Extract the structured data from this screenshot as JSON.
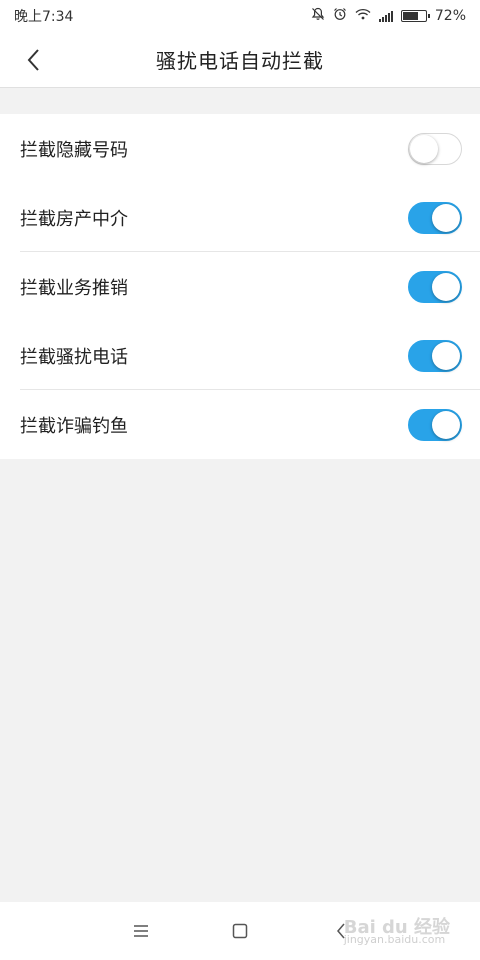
{
  "status_bar": {
    "time": "晚上7:34",
    "battery_percent": "72%",
    "battery_level": 0.72,
    "icons": [
      "bell-off-icon",
      "alarm-icon",
      "wifi-icon",
      "signal-icon",
      "battery-icon"
    ]
  },
  "header": {
    "title": "骚扰电话自动拦截",
    "back_icon": "chevron-left-icon"
  },
  "settings": [
    {
      "label": "拦截隐藏号码",
      "enabled": false
    },
    {
      "label": "拦截房产中介",
      "enabled": true
    },
    {
      "label": "拦截业务推销",
      "enabled": true
    },
    {
      "label": "拦截骚扰电话",
      "enabled": true
    },
    {
      "label": "拦截诈骗钓鱼",
      "enabled": true
    }
  ],
  "nav_bar": {
    "buttons": [
      "menu-icon",
      "home-icon",
      "back-icon"
    ]
  },
  "watermark": {
    "brand": "Bai du 经验",
    "url": "jingyan.baidu.com"
  },
  "colors": {
    "toggle_on": "#29a3e8",
    "background": "#f2f2f2"
  }
}
